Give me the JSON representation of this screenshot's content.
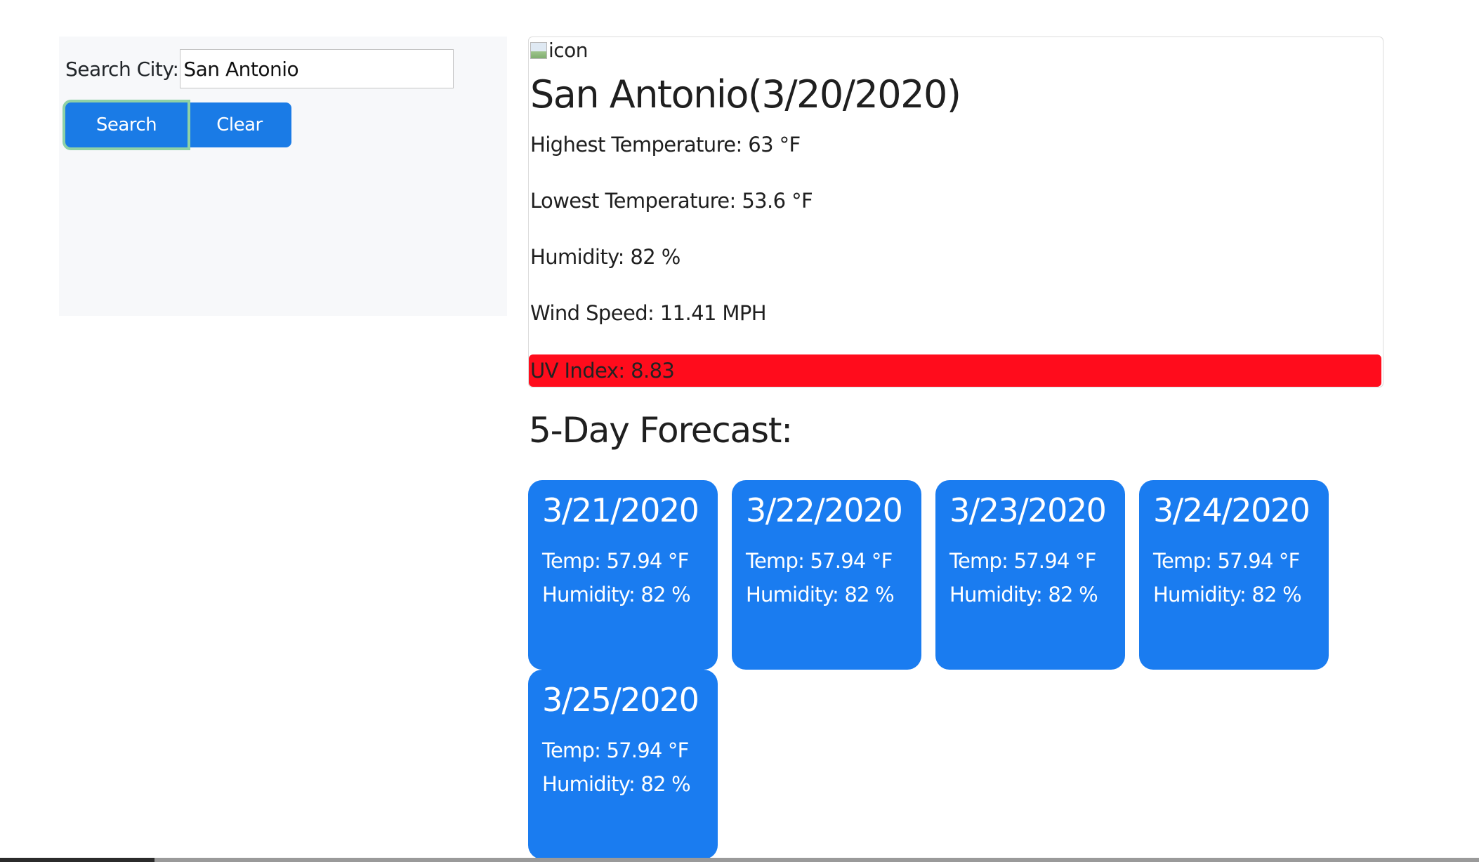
{
  "search": {
    "label": "Search City:",
    "value": "San Antonio",
    "search_button": "Search",
    "clear_button": "Clear"
  },
  "current": {
    "icon_alt": "icon",
    "city_title": "San Antonio(3/20/2020)",
    "high_temp": "Highest Temperature: 63 °F",
    "low_temp": "Lowest Temperature: 53.6 °F",
    "humidity": "Humidity: 82 %",
    "wind_speed": "Wind Speed: 11.41 MPH",
    "uv_index": "UV Index: 8.83",
    "uv_color": "#ff0c1c"
  },
  "forecast": {
    "heading": "5-Day Forecast:",
    "card_color": "#1a7cf0",
    "days": [
      {
        "date": "3/21/2020",
        "temp": "Temp: 57.94 °F",
        "humidity": "Humidity: 82 %"
      },
      {
        "date": "3/22/2020",
        "temp": "Temp: 57.94 °F",
        "humidity": "Humidity: 82 %"
      },
      {
        "date": "3/23/2020",
        "temp": "Temp: 57.94 °F",
        "humidity": "Humidity: 82 %"
      },
      {
        "date": "3/24/2020",
        "temp": "Temp: 57.94 °F",
        "humidity": "Humidity: 82 %"
      },
      {
        "date": "3/25/2020",
        "temp": "Temp: 57.94 °F",
        "humidity": "Humidity: 82 %"
      }
    ]
  }
}
